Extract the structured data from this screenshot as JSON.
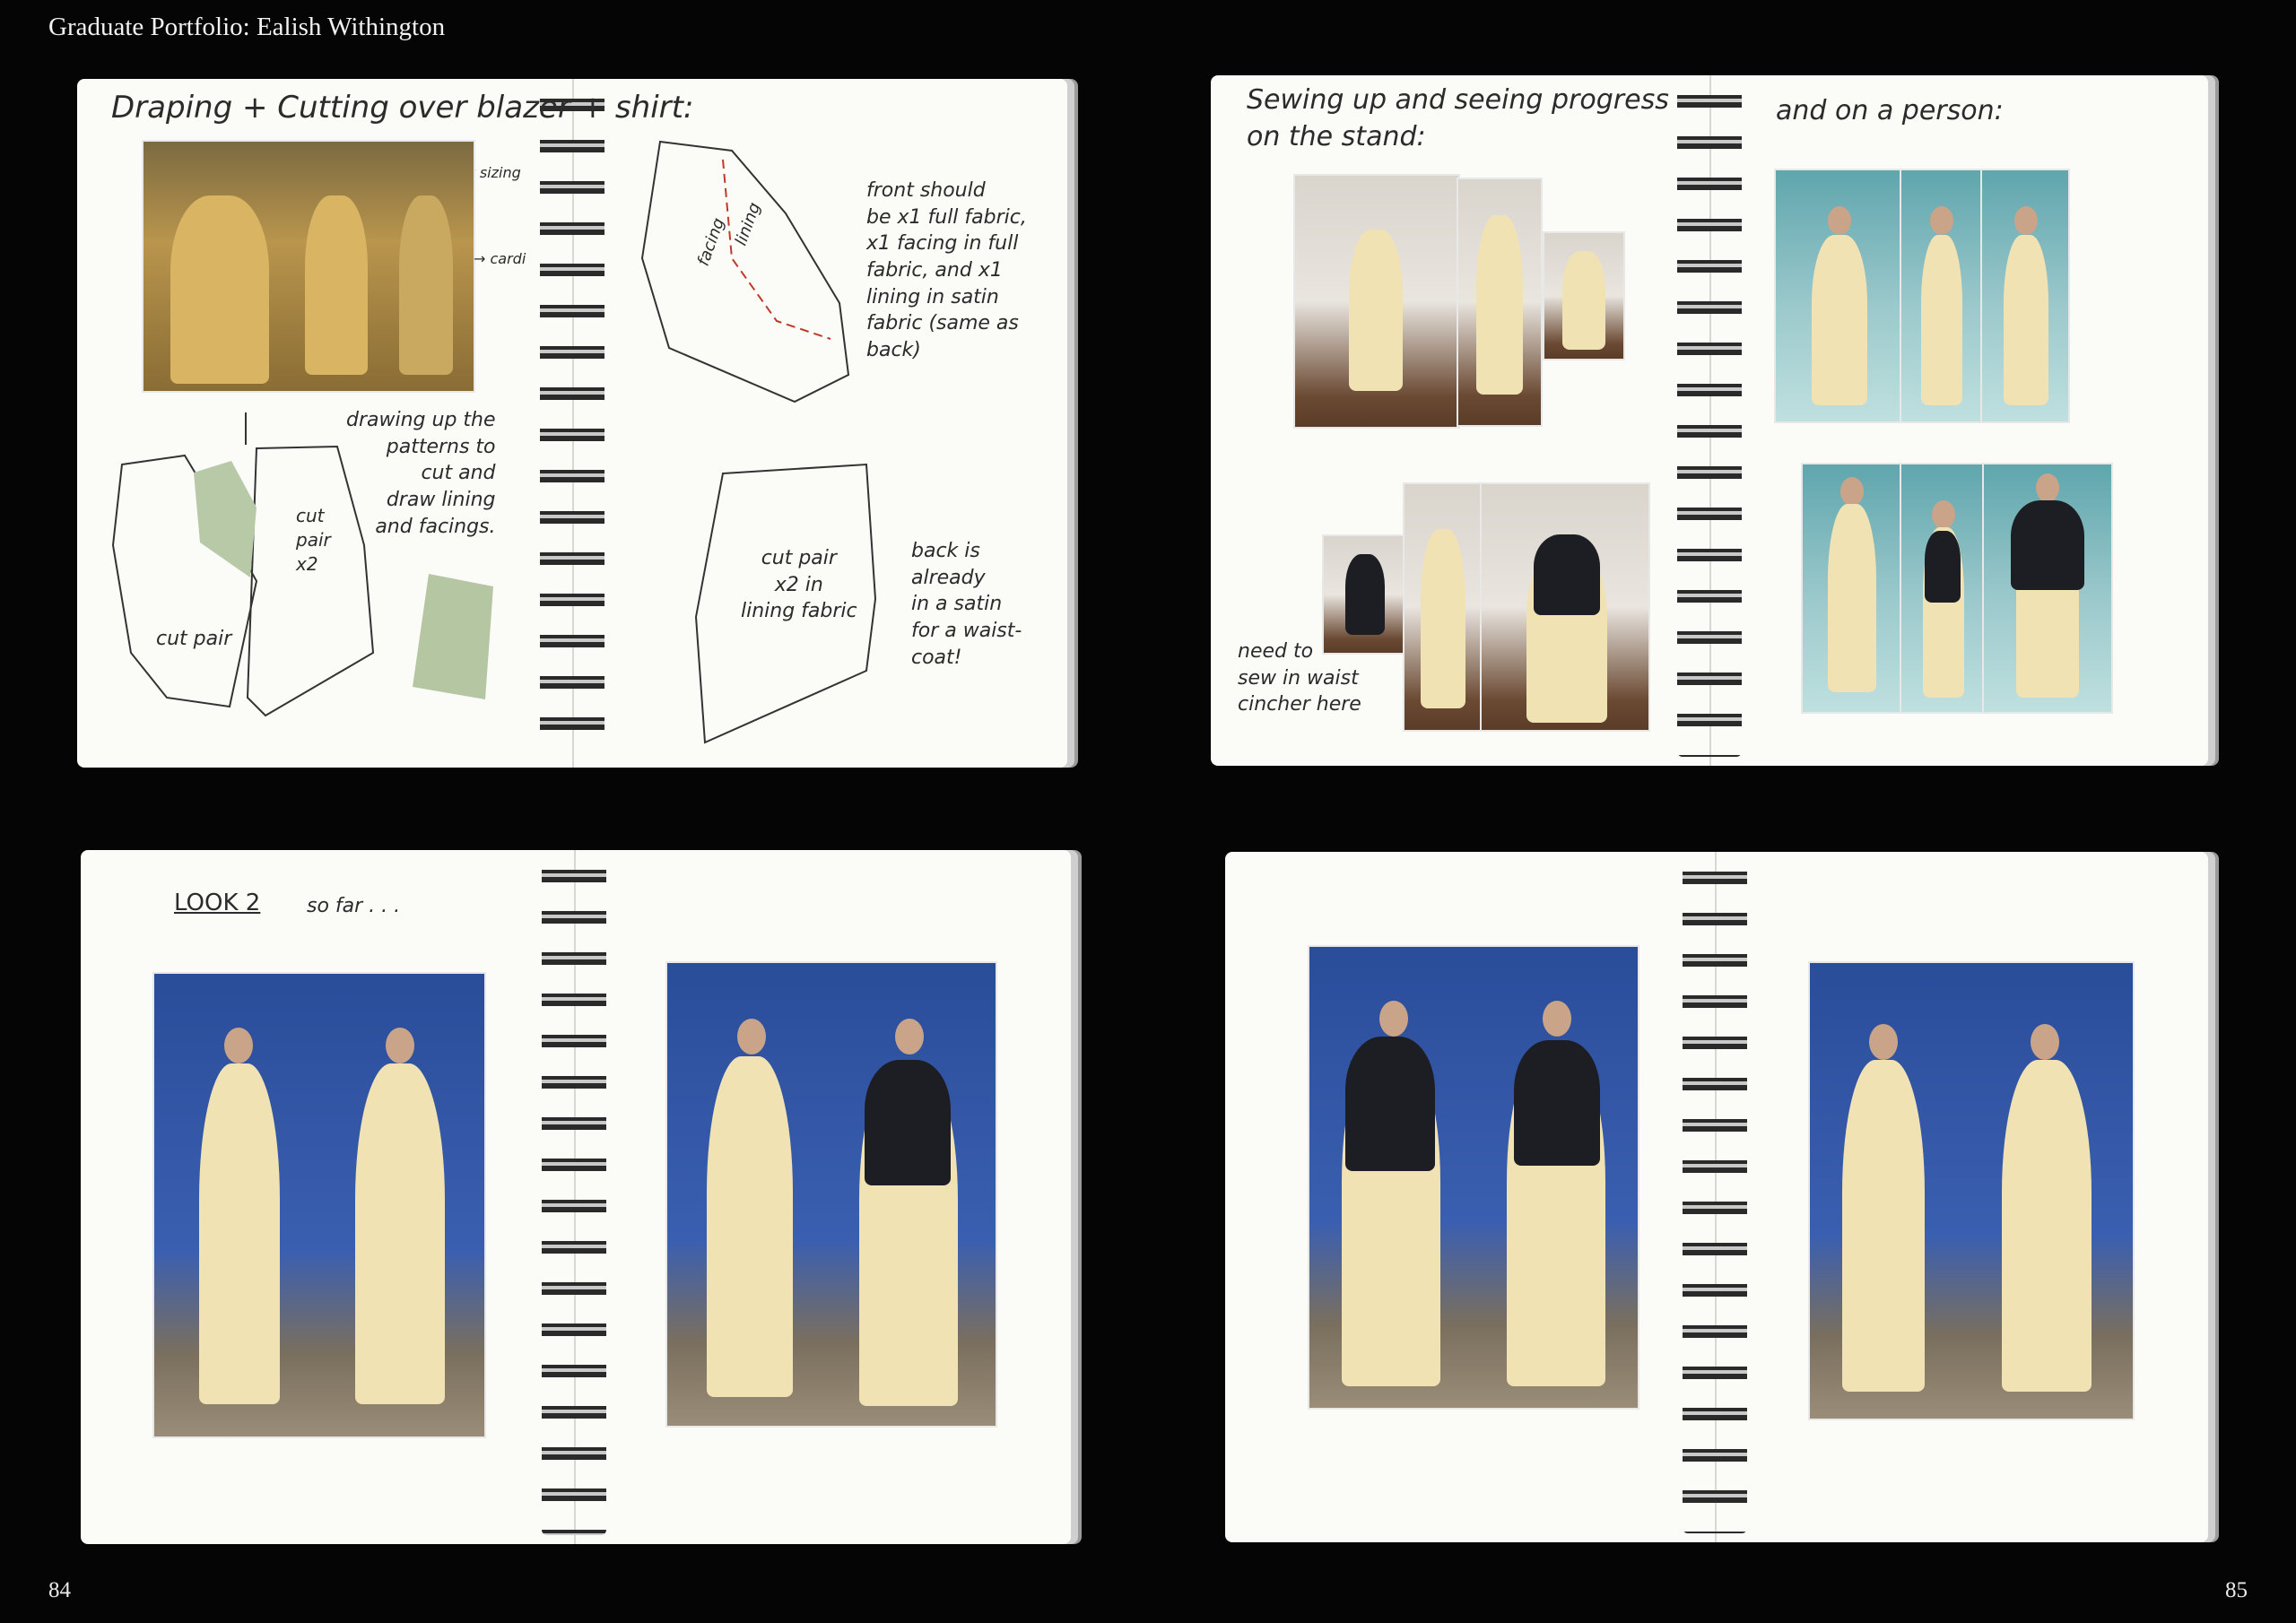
{
  "header": {
    "title": "Graduate Portfolio: Ealish Withington"
  },
  "page_numbers": {
    "left": "84",
    "right": "85"
  },
  "spread1": {
    "title": "Draping + Cutting over blazer + shirt:",
    "sizing_note": "for correct sizing",
    "arrow_label": "→ cardi",
    "drawing_note": "drawing up the\npatterns to\ncut and\ndraw lining\nand facings.",
    "cut_pair_a": "cut pair",
    "cut_pair_b": "cut\npair\nx2",
    "front_note": "front should\nbe x1 full fabric,\nx1 facing in full\nfabric, and x1\nlining in satin\nfabric (same as\nback)",
    "facing_label": "facing",
    "lining_label": "lining",
    "back_piece": "cut pair\nx2 in\nlining fabric",
    "back_note": "back is\nalready\nin a satin\nfor a waist-\ncoat!"
  },
  "spread2": {
    "title": "Sewing up and seeing progress\non the stand:",
    "title_right": "and on a person:",
    "waist_note": "need to\nsew in waist\ncincher here"
  },
  "spread3": {
    "title": "LOOK 2",
    "subtitle": "so far . . ."
  }
}
